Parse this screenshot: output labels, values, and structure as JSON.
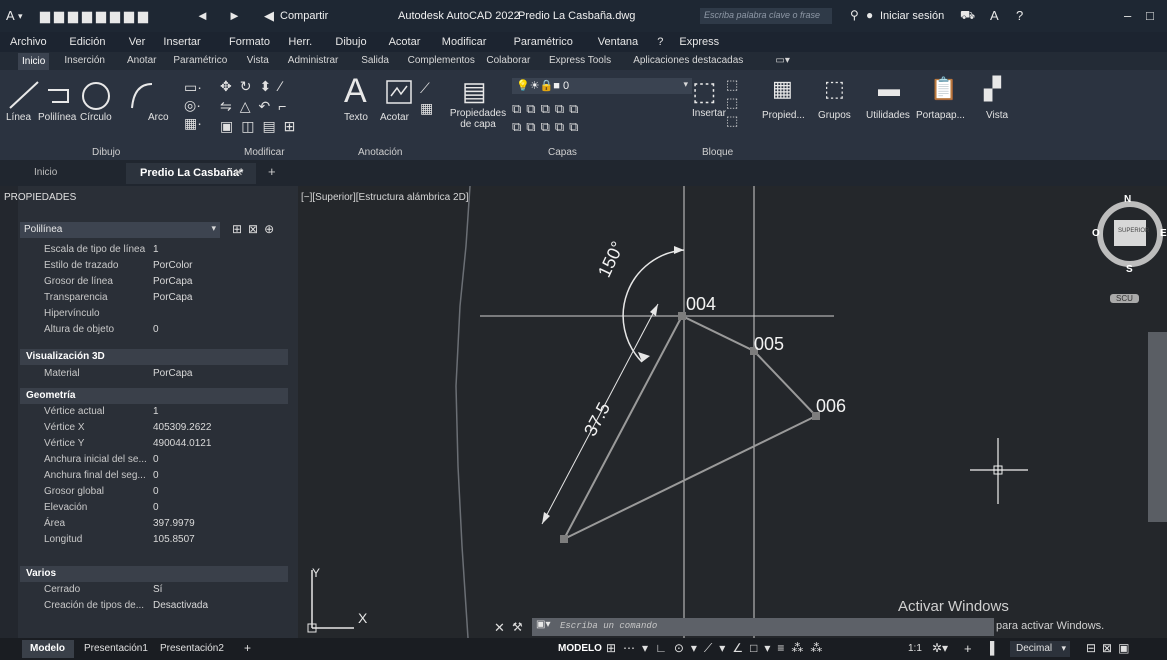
{
  "titlebar": {
    "share_label": "Compartir",
    "app_title": "Autodesk AutoCAD 2022",
    "file_title": "Predio La Casbaña.dwg",
    "search_placeholder": "Escriba palabra clave o frase",
    "signin_label": "Iniciar sesión"
  },
  "menubar": [
    "Archivo",
    "Edición",
    "Ver",
    "Insertar",
    "Formato",
    "Herr.",
    "Dibujo",
    "Acotar",
    "Modificar",
    "Paramétrico",
    "Ventana",
    "?",
    "Express"
  ],
  "ribbon_tabs": [
    "Inicio",
    "Inserción",
    "Anotar",
    "Paramétrico",
    "Vista",
    "Administrar",
    "Salida",
    "Complementos",
    "Colaborar",
    "Express Tools",
    "Aplicaciones destacadas"
  ],
  "ribbon": {
    "draw_tools": [
      "Línea",
      "Polilínea",
      "Círculo",
      "Arco"
    ],
    "draw_panel": "Dibujo",
    "modify_panel": "Modificar",
    "text_label": "Texto",
    "dim_label": "Acotar",
    "annotation_panel": "Anotación",
    "layer_props_label": "Propiedades de capa",
    "layers_panel": "Capas",
    "insert_label": "Insertar",
    "block_panel": "Bloque",
    "props_label": "Propied...",
    "groups_label": "Grupos",
    "utilities_label": "Utilidades",
    "clipboard_label": "Portapap...",
    "view_label": "Vista"
  },
  "file_tabs": {
    "start": "Inicio",
    "active": "Predio La Casbaña*"
  },
  "properties": {
    "title": "PROPIEDADES",
    "object_type": "Polilínea",
    "general": [
      {
        "k": "Escala de tipo de línea",
        "v": "1"
      },
      {
        "k": "Estilo de trazado",
        "v": "PorColor"
      },
      {
        "k": "Grosor de línea",
        "v": "PorCapa"
      },
      {
        "k": "Transparencia",
        "v": "PorCapa"
      },
      {
        "k": "Hipervínculo",
        "v": ""
      },
      {
        "k": "Altura de objeto",
        "v": "0"
      }
    ],
    "vis3d_title": "Visualización 3D",
    "vis3d": [
      {
        "k": "Material",
        "v": "PorCapa"
      }
    ],
    "geom_title": "Geometría",
    "geom": [
      {
        "k": "Vértice actual",
        "v": "1"
      },
      {
        "k": "Vértice X",
        "v": "405309.2622"
      },
      {
        "k": "Vértice Y",
        "v": "490044.0121"
      },
      {
        "k": "Anchura inicial del se...",
        "v": "0"
      },
      {
        "k": "Anchura final del seg...",
        "v": "0"
      },
      {
        "k": "Grosor global",
        "v": "0"
      },
      {
        "k": "Elevación",
        "v": "0"
      },
      {
        "k": "Área",
        "v": "397.9979"
      },
      {
        "k": "Longitud",
        "v": "105.8507"
      }
    ],
    "misc_title": "Varios",
    "misc": [
      {
        "k": "Cerrado",
        "v": "Sí"
      },
      {
        "k": "Creación de tipos de...",
        "v": "Desactivada"
      }
    ]
  },
  "viewport": {
    "label": "[−][Superior][Estructura alámbrica 2D]",
    "points": [
      "004",
      "005",
      "006"
    ],
    "angle": "150°",
    "distance": "37.5",
    "compass_n": "N",
    "compass_s": "S",
    "compass_e": "E",
    "compass_o": "O",
    "cube_label": "SUPERIOR",
    "scu_label": "SCU",
    "axis_x": "X",
    "axis_y": "Y",
    "command_placeholder": "Escriba un comando",
    "activate_title": "Activar Windows",
    "activate_sub": "para activar Windows."
  },
  "status": {
    "tabs": [
      "Modelo",
      "Presentación1",
      "Presentación2"
    ],
    "model_label": "MODELO",
    "scale": "1:1",
    "units": "Decimal"
  }
}
